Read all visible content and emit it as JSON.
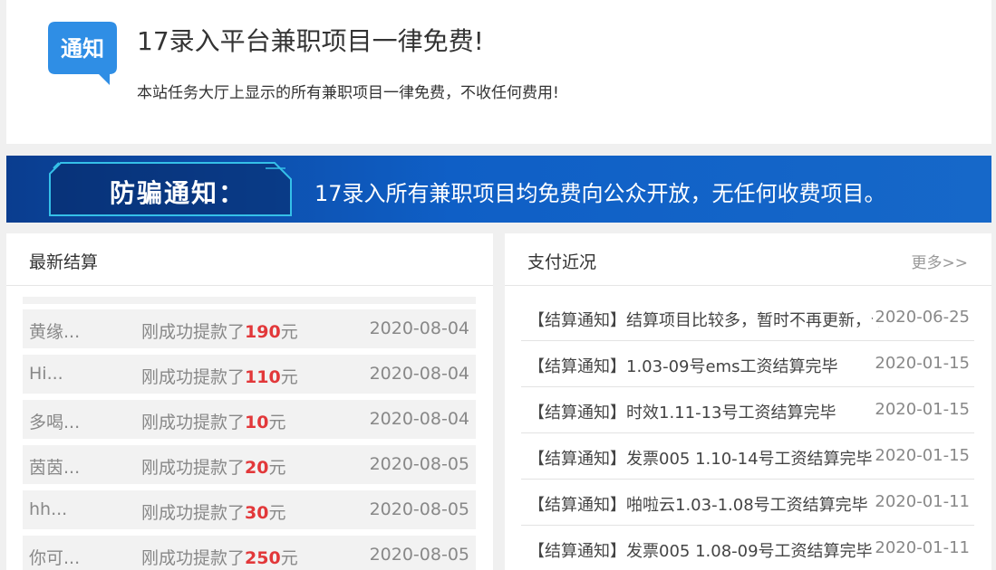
{
  "notice": {
    "icon_label": "通知",
    "title": "17录入平台兼职项目一律免费!",
    "description": "本站任务大厅上显示的所有兼职项目一律免费，不收任何费用!"
  },
  "banner": {
    "label": "防骗通知：",
    "text": "17录入所有兼职项目均免费向公众开放，无任何收费项目。"
  },
  "settlements": {
    "title": "最新结算",
    "action_text": "刚成功提款了",
    "currency": "元",
    "rows": [
      {
        "name": "黄缘...",
        "amount": "190",
        "date": "2020-08-04"
      },
      {
        "name": "Hi...",
        "amount": "110",
        "date": "2020-08-04"
      },
      {
        "name": "多喝...",
        "amount": "10",
        "date": "2020-08-04"
      },
      {
        "name": "茵茵...",
        "amount": "20",
        "date": "2020-08-05"
      },
      {
        "name": "hh...",
        "amount": "30",
        "date": "2020-08-05"
      },
      {
        "name": "你可...",
        "amount": "250",
        "date": "2020-08-05"
      }
    ]
  },
  "payments": {
    "title": "支付近况",
    "more_label": "更多>>",
    "rows": [
      {
        "title": "【结算通知】结算项目比较多，暂时不再更新，个",
        "date": "2020-06-25"
      },
      {
        "title": "【结算通知】1.03-09号ems工资结算完毕",
        "date": "2020-01-15"
      },
      {
        "title": "【结算通知】时效1.11-13号工资结算完毕",
        "date": "2020-01-15"
      },
      {
        "title": "【结算通知】发票005 1.10-14号工资结算完毕",
        "date": "2020-01-15"
      },
      {
        "title": "【结算通知】啪啦云1.03-1.08号工资结算完毕",
        "date": "2020-01-11"
      },
      {
        "title": "【结算通知】发票005 1.08-09号工资结算完毕",
        "date": "2020-01-11"
      }
    ]
  },
  "colors": {
    "accent_blue": "#1668c9",
    "amount_red": "#e2383a",
    "icon_blue": "#2f8ee5"
  }
}
